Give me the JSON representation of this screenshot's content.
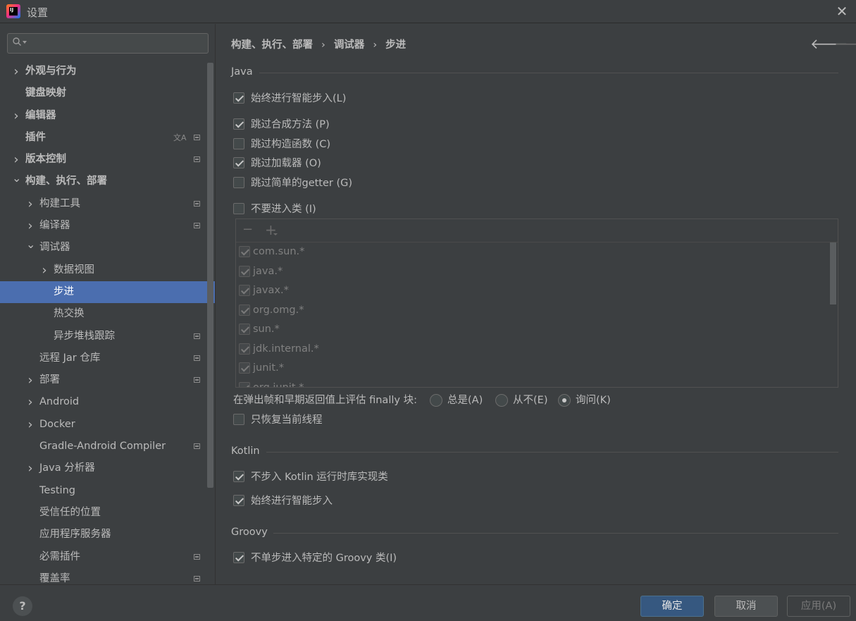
{
  "window": {
    "title": "设置"
  },
  "sidebar": {
    "search": {
      "value": "",
      "placeholder": ""
    },
    "items": [
      {
        "label": "外观与行为",
        "bold": true,
        "chevron": "right",
        "indent": 0
      },
      {
        "label": "键盘映射",
        "bold": true,
        "chevron": "",
        "indent": 0
      },
      {
        "label": "编辑器",
        "bold": true,
        "chevron": "right",
        "indent": 0
      },
      {
        "label": "插件",
        "bold": true,
        "chevron": "",
        "indent": 0,
        "translate_icon": true,
        "project_icon": true
      },
      {
        "label": "版本控制",
        "bold": true,
        "chevron": "right",
        "indent": 0,
        "project_icon": true
      },
      {
        "label": "构建、执行、部署",
        "bold": true,
        "chevron": "down",
        "indent": 0
      },
      {
        "label": "构建工具",
        "chevron": "right",
        "indent": 1,
        "project_icon": true
      },
      {
        "label": "编译器",
        "chevron": "right",
        "indent": 1,
        "project_icon": true
      },
      {
        "label": "调试器",
        "chevron": "down",
        "indent": 1
      },
      {
        "label": "数据视图",
        "chevron": "right",
        "indent": 2
      },
      {
        "label": "步进",
        "chevron": "",
        "indent": 2,
        "selected": true
      },
      {
        "label": "热交换",
        "chevron": "",
        "indent": 2
      },
      {
        "label": "异步堆栈跟踪",
        "chevron": "",
        "indent": 2,
        "project_icon": true
      },
      {
        "label": "远程 Jar 仓库",
        "chevron": "",
        "indent": 1,
        "project_icon": true
      },
      {
        "label": "部署",
        "chevron": "right",
        "indent": 1,
        "project_icon": true
      },
      {
        "label": "Android",
        "chevron": "right",
        "indent": 1
      },
      {
        "label": "Docker",
        "chevron": "right",
        "indent": 1
      },
      {
        "label": "Gradle-Android Compiler",
        "chevron": "",
        "indent": 1,
        "project_icon": true
      },
      {
        "label": "Java 分析器",
        "chevron": "right",
        "indent": 1
      },
      {
        "label": "Testing",
        "chevron": "",
        "indent": 1
      },
      {
        "label": "受信任的位置",
        "chevron": "",
        "indent": 1
      },
      {
        "label": "应用程序服务器",
        "chevron": "",
        "indent": 1
      },
      {
        "label": "必需插件",
        "chevron": "",
        "indent": 1,
        "project_icon": true
      },
      {
        "label": "覆盖率",
        "chevron": "",
        "indent": 1,
        "project_icon": true
      }
    ]
  },
  "breadcrumb": {
    "part1": "构建、执行、部署",
    "part2": "调试器",
    "part3": "步进",
    "separator": "›"
  },
  "nav": {
    "back": "🡐",
    "forward": "🡒"
  },
  "java": {
    "title": "Java",
    "smart_step": {
      "label": "始终进行智能步入(L)",
      "checked": true
    },
    "skip_synthetic": {
      "label": "跳过合成方法 (P)",
      "checked": true
    },
    "skip_constructors": {
      "label": "跳过构造函数 (C)",
      "checked": false
    },
    "skip_classloaders": {
      "label": "跳过加载器 (O)",
      "checked": true
    },
    "skip_getters": {
      "label": "跳过简单的getter (G)",
      "checked": false
    },
    "do_not_step": {
      "label": "不要进入类 (I)",
      "checked": false
    },
    "class_filters": [
      {
        "pattern": "com.sun.*",
        "checked": true
      },
      {
        "pattern": "java.*",
        "checked": true
      },
      {
        "pattern": "javax.*",
        "checked": true
      },
      {
        "pattern": "org.omg.*",
        "checked": true
      },
      {
        "pattern": "sun.*",
        "checked": true
      },
      {
        "pattern": "jdk.internal.*",
        "checked": true
      },
      {
        "pattern": "junit.*",
        "checked": true
      },
      {
        "pattern": "org.junit.*",
        "checked": true
      }
    ],
    "finally_eval": {
      "label": "在弹出帧和早期返回值上评估 finally 块:",
      "options": [
        {
          "label": "总是(A)",
          "selected": false
        },
        {
          "label": "从不(E)",
          "selected": false
        },
        {
          "label": "询问(K)",
          "selected": true
        }
      ]
    },
    "resume_only_current": {
      "label": "只恢复当前线程",
      "checked": false
    }
  },
  "kotlin": {
    "title": "Kotlin",
    "no_step_runtime": {
      "label": "不步入 Kotlin 运行时库实现类",
      "checked": true
    },
    "smart_step": {
      "label": "始终进行智能步入",
      "checked": true
    }
  },
  "groovy": {
    "title": "Groovy",
    "no_step_specific": {
      "label": "不单步进入特定的 Groovy 类(I)",
      "checked": true
    }
  },
  "footer": {
    "help": "?",
    "ok": "确定",
    "cancel": "取消",
    "apply": "应用(A)"
  }
}
